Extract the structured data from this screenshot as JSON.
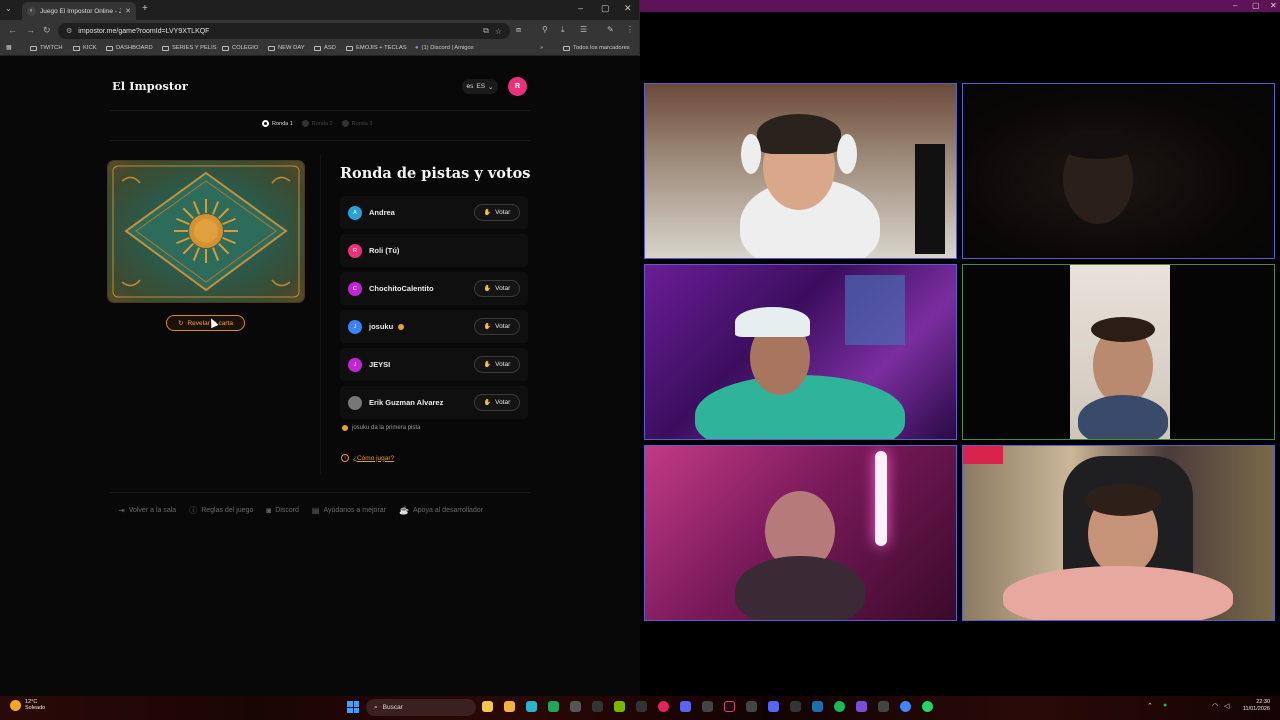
{
  "browser": {
    "tab_title": "Juego El Impostor Online - Jug",
    "url": "impostor.me/game?roomId=LVY9XTLKQF",
    "bookmarks": [
      "TWITCH",
      "KICK",
      "DASHBOARD",
      "SERIES Y PELIS",
      "COLEGIO",
      "NEW DAY",
      "ASD",
      "EMOJIS + TECLAS",
      "(1) Discord | Amigos"
    ],
    "all_bookmarks": "Todos los marcadores"
  },
  "game": {
    "brand": "El Impostor",
    "language": "ES",
    "language_code": "es",
    "user_initial": "R",
    "rounds": [
      "Ronda 1",
      "Ronda 2",
      "Ronda 3"
    ],
    "active_round": 0,
    "reveal_button": "Revelar la carta",
    "section_title": "Ronda de pistas y votos",
    "vote_label": "Votar",
    "players": [
      {
        "initial": "A",
        "name": "Andrea",
        "color": "#2a9fd8",
        "can_vote": true,
        "turn": false
      },
      {
        "initial": "R",
        "name": "Roli (Tú)",
        "color": "#e7337a",
        "can_vote": false,
        "turn": false
      },
      {
        "initial": "C",
        "name": "ChochitoCalentito",
        "color": "#c026d3",
        "can_vote": true,
        "turn": false
      },
      {
        "initial": "J",
        "name": "josuku",
        "color": "#3b82f6",
        "can_vote": true,
        "turn": true
      },
      {
        "initial": "J",
        "name": "JEYSI",
        "color": "#c026d3",
        "can_vote": true,
        "turn": false
      },
      {
        "initial": "",
        "name": "Erik Guzman Alvarez",
        "color": "#777777",
        "can_vote": true,
        "turn": false
      }
    ],
    "hint_text": "josuku da la primera pista",
    "how_to": "¿Cómo jugar?",
    "footer": [
      "Volver a la sala",
      "Reglas del juego",
      "Discord",
      "Ayúdanos a mejorar",
      "Apoya al desarrollador"
    ]
  },
  "taskbar": {
    "temperature": "12°C",
    "weather": "Soleado",
    "search_placeholder": "Buscar",
    "time": "22:30",
    "date": "11/01/2026"
  },
  "colors": {
    "accent_orange": "#e59a2c",
    "avatar_pink": "#e7337a",
    "call_titlebar": "#5d1357",
    "tile_border": "#5a5fc8"
  }
}
